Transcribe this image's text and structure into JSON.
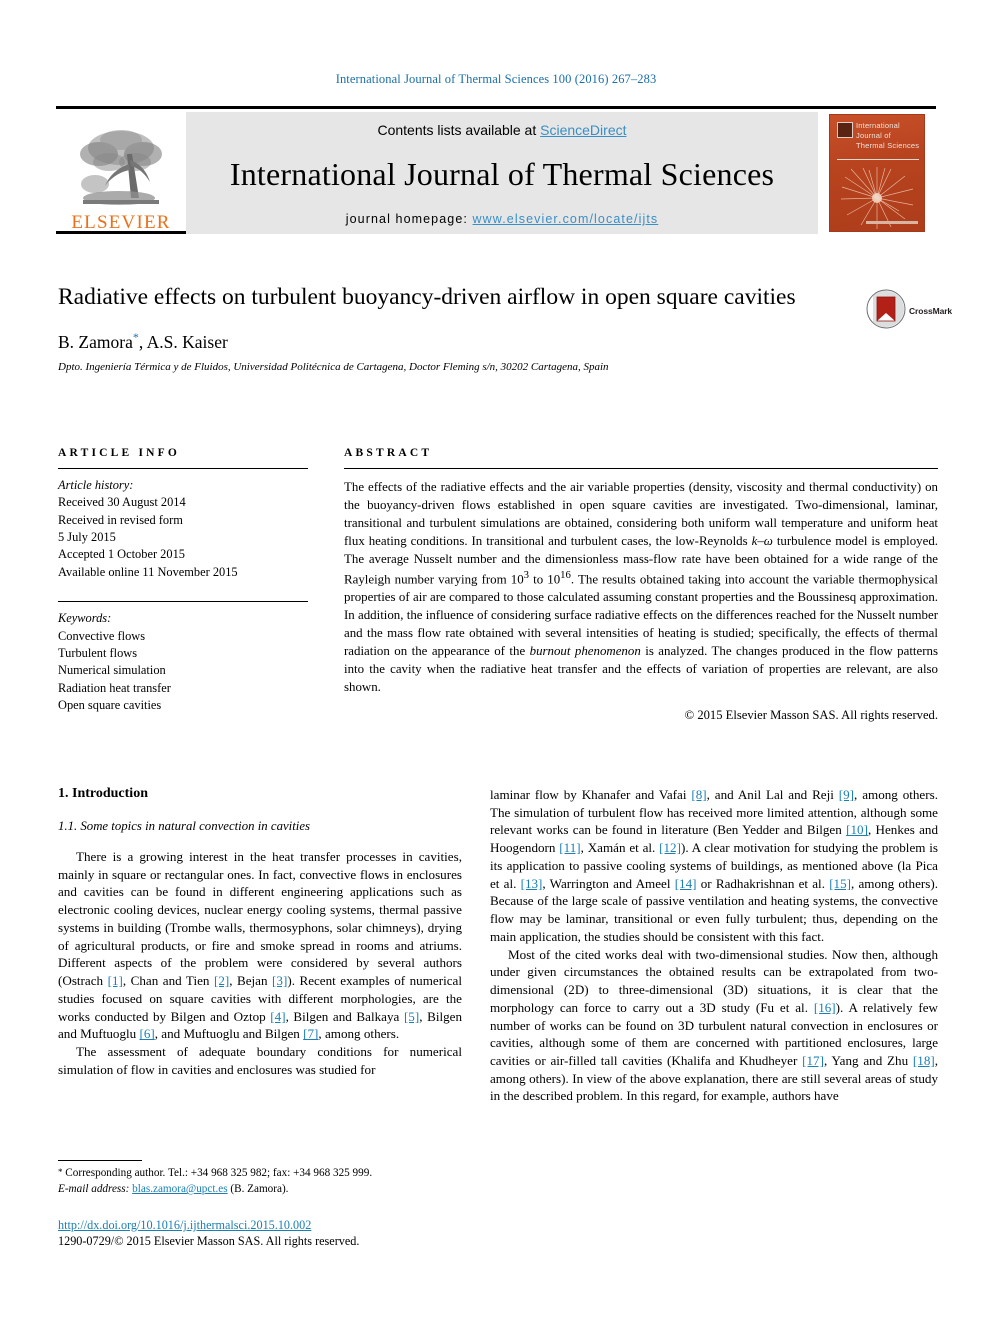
{
  "running_head": "International Journal of Thermal Sciences 100 (2016) 267–283",
  "masthead": {
    "contents_prefix": "Contents lists available at ",
    "sciencedirect": "ScienceDirect",
    "journal_name": "International Journal of Thermal Sciences",
    "homepage_prefix": "journal homepage: ",
    "homepage_url": "www.elsevier.com/locate/ijts",
    "publisher": "ELSEVIER",
    "cover_title": "International Journal of Thermal Sciences",
    "link_color": "#3a8fc4",
    "publisher_color": "#E9711C"
  },
  "article": {
    "title": "Radiative effects on turbulent buoyancy-driven airflow in open square cavities",
    "authors": "B. Zamora",
    "authors_rest": ", A.S. Kaiser",
    "corresponding_marker": "*",
    "affiliation": "Dpto. Ingeniería Térmica y de Fluidos, Universidad Politécnica de Cartagena, Doctor Fleming s/n, 30202 Cartagena, Spain",
    "crossmark_label": "CrossMark"
  },
  "article_info": {
    "heading": "ARTICLE INFO",
    "history_label": "Article history:",
    "history": [
      "Received 30 August 2014",
      "Received in revised form",
      "5 July 2015",
      "Accepted 1 October 2015",
      "Available online 11 November 2015"
    ],
    "keywords_label": "Keywords:",
    "keywords": [
      "Convective flows",
      "Turbulent flows",
      "Numerical simulation",
      "Radiation heat transfer",
      "Open square cavities"
    ]
  },
  "abstract": {
    "heading": "ABSTRACT",
    "part1": "The effects of the radiative effects and the air variable properties (density, viscosity and thermal conductivity) on the buoyancy-driven flows established in open square cavities are investigated. Two-dimensional, laminar, transitional and turbulent simulations are obtained, considering both uniform wall temperature and uniform heat flux heating conditions. In transitional and turbulent cases, the low-Reynolds ",
    "turbulence_model": "k–ω",
    "part2": " turbulence model is employed. The average Nusselt number and the dimensionless mass-flow rate have been obtained for a wide range of the Rayleigh number varying from 10",
    "exp1": "3",
    "part3": " to 10",
    "exp2": "16",
    "part4": ". The results obtained taking into account the variable thermophysical properties of air are compared to those calculated assuming constant properties and the Boussinesq approximation. In addition, the influence of considering surface radiative effects on the differences reached for the Nusselt number and the mass flow rate obtained with several intensities of heating is studied; specifically, the effects of thermal radiation on the appearance of the ",
    "italic_term": "burnout phenomenon",
    "part5": " is analyzed. The changes produced in the flow patterns into the cavity when the radiative heat transfer and the effects of variation of properties are relevant, are also shown.",
    "copyright": "© 2015 Elsevier Masson SAS. All rights reserved."
  },
  "body": {
    "section_number_title": "1. Introduction",
    "subsection_title": "1.1. Some topics in natural convection in cavities",
    "left_para1_a": "There is a growing interest in the heat transfer processes in cavities, mainly in square or rectangular ones. In fact, convective flows in enclosures and cavities can be found in different engineering applications such as electronic cooling devices, nuclear energy cooling systems, thermal passive systems in building (Trombe walls, thermosyphons, solar chimneys), drying of agricultural products, or fire and smoke spread in rooms and atriums. Different aspects of the problem were considered by several authors (Ostrach ",
    "r1": "[1]",
    "left_para1_b": ", Chan and Tien ",
    "r2": "[2]",
    "left_para1_c": ", Bejan ",
    "r3": "[3]",
    "left_para1_d": "). Recent examples of numerical studies focused on square cavities with different morphologies, are the works conducted by Bilgen and Oztop ",
    "r4": "[4]",
    "left_para1_e": ", Bilgen and Balkaya ",
    "r5": "[5]",
    "left_para1_f": ", Bilgen and Muftuoglu ",
    "r6": "[6]",
    "left_para1_g": ", and Muftuoglu and Bilgen ",
    "r7": "[7]",
    "left_para1_h": ", among others.",
    "left_para2_a": "The assessment of adequate boundary conditions for numerical simulation of flow in cavities and enclosures was studied for",
    "right_para1_a": "laminar flow by Khanafer and Vafai ",
    "r8": "[8]",
    "right_para1_b": ", and Anil Lal and Reji ",
    "r9": "[9]",
    "right_para1_c": ", among others. The simulation of turbulent flow has received more limited attention, although some relevant works can be found in literature (Ben Yedder and Bilgen ",
    "r10": "[10]",
    "right_para1_d": ", Henkes and Hoogendorn ",
    "r11": "[11]",
    "right_para1_e": ", Xamán et al. ",
    "r12": "[12]",
    "right_para1_f": "). A clear motivation for studying the problem is its application to passive cooling systems of buildings, as mentioned above (la Pica et al. ",
    "r13": "[13]",
    "right_para1_g": ", Warrington and Ameel ",
    "r14": "[14]",
    "right_para1_h": " or Radhakrishnan et al. ",
    "r15": "[15]",
    "right_para1_i": ", among others). Because of the large scale of passive ventilation and heating systems, the convective flow may be laminar, transitional or even fully turbulent; thus, depending on the main application, the studies should be consistent with this fact.",
    "right_para2_a": "Most of the cited works deal with two-dimensional studies. Now then, although under given circumstances the obtained results can be extrapolated from two-dimensional (2D) to three-dimensional (3D) situations, it is clear that the morphology can force to carry out a 3D study (Fu et al. ",
    "r16": "[16]",
    "right_para2_b": "). A relatively few number of works can be found on 3D turbulent natural convection in enclosures or cavities, although some of them are concerned with partitioned enclosures, large cavities or air-filled tall cavities (Khalifa and Khudheyer ",
    "r17": "[17]",
    "right_para2_c": ", Yang and Zhu ",
    "r18": "[18]",
    "right_para2_d": ", among others). In view of the above explanation, there are still several areas of study in the described problem. In this regard, for example, authors have",
    "ref_color": "#1a7fb5"
  },
  "footnote": {
    "marker": "*",
    "corresponding": " Corresponding author. Tel.: +34 968 325 982; fax: +34 968 325 999.",
    "email_label": "E-mail address:",
    "email": "blas.zamora@upct.es",
    "email_owner": " (B. Zamora)."
  },
  "bottom": {
    "doi": "http://dx.doi.org/10.1016/j.ijthermalsci.2015.10.002",
    "issn_copyright": "1290-0729/© 2015 Elsevier Masson SAS. All rights reserved."
  }
}
